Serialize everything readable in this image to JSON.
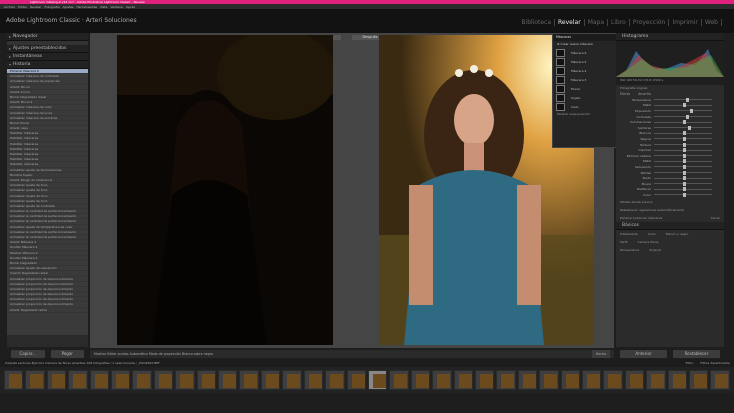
{
  "window": {
    "title": "Lightroom Catalog-2-v12 v17 - Adobe Photoshop Lightroom Classic - Revelar"
  },
  "menu": [
    "Archivo",
    "Editar",
    "Revelar",
    "Fotografía",
    "Ajustes",
    "Herramientas",
    "Vista",
    "Ventana",
    "Ayuda"
  ],
  "brand": "Adobe Lightroom Classic · Arteri Soluciones",
  "modules": [
    "Biblioteca",
    "Revelar",
    "Mapa",
    "Libro",
    "Proyección",
    "Imprimir",
    "Web"
  ],
  "active_module": "Revelar",
  "left_panel": {
    "navigator": "Navegador",
    "presets": "Ajustes preestablecidos",
    "snapshots": "Instantáneas",
    "history": "Historia",
    "history_items": [
      "Eliminar Máscara 6",
      "Actualizar máscara de contraste",
      "Actualizar máscara de exposición",
      "Añadir Pincel",
      "Añadir Curva",
      "Borrar Degradado lineal",
      "Añadir Pincel 2",
      "Actualizar máscara de color",
      "Actualizar máscara de luces",
      "Actualizar máscara de sombras",
      "Borrar Pincel",
      "Añadir capa",
      "Habilitar máscaras",
      "Habilitar máscaras",
      "Habilitar máscaras",
      "Habilitar máscaras",
      "Habilitar máscaras",
      "Habilitar máscaras",
      "Habilitar máscaras",
      "Actualizar ajuste de Iluminaciones",
      "Nombre Sujeto",
      "Añadir Rango de luminancia",
      "Actualizar Ajuste de tono",
      "Actualizar Ajuste de tono",
      "Actualizar Ajuste de tono",
      "Actualizar Ajuste de tono",
      "Actualizar ajuste de contraste",
      "Actualizar la cantidad de perfeccionamiento",
      "Actualizar la cantidad de perfeccionamiento",
      "Actualizar la cantidad de perfeccionamiento",
      "Actualizar ajuste de temperatura de color",
      "Actualizar la cantidad de perfeccionamiento",
      "Actualizar la cantidad de perfeccionamiento",
      "Añadir Máscara 2",
      "Ocultar Máscara 2",
      "Mostrar Máscara 2",
      "Ocultar Máscara 2",
      "Borrar Degradado",
      "Actualizar ajuste de exposición",
      "Invertir Degradado radial",
      "Actualizar proporción de desconocimiento",
      "Actualizar proporción de desconocimiento",
      "Actualizar proporción de desconocimiento",
      "Actualizar proporción de desconocimiento",
      "Actualizar proporción de desconocimiento",
      "Actualizar proporción de desconocimiento",
      "Añadir Degradado radial"
    ],
    "copy_button": "Copiar...",
    "paste_button": "Pegar"
  },
  "center": {
    "before_label": "Antes",
    "after_label": "Después",
    "toolbar_text": "Mostrar Editar puntos   Automático   Modo de proyección   Blanco sobre negro",
    "ready_button": "Hecho"
  },
  "masks_panel": {
    "title": "Máscaras",
    "create": "Crear nueva máscara",
    "items": [
      "Máscara 6",
      "Máscara 5",
      "Máscara 4",
      "Máscara 3",
      "Pincel",
      "Sujeto",
      "Cielo"
    ],
    "footer": "Mostrar superposición"
  },
  "right_panel": {
    "histogram_title": "Histograma",
    "histogram_info": "ISO 100   50 mm   f/2,8   1/500 s",
    "original_photo": "Fotografía original",
    "effect_label": "Efecto",
    "effect_value": "Amarillo",
    "sliders": [
      {
        "name": "Temperatura",
        "value": 0.55
      },
      {
        "name": "Matiz",
        "value": 0.5
      },
      {
        "name": "Exposición",
        "value": 0.62
      },
      {
        "name": "Contraste",
        "value": 0.55
      },
      {
        "name": "Iluminaciones",
        "value": 0.5
      },
      {
        "name": "Sombras",
        "value": 0.58
      },
      {
        "name": "Blancos",
        "value": 0.5
      },
      {
        "name": "Negros",
        "value": 0.5
      },
      {
        "name": "Textura",
        "value": 0.5
      },
      {
        "name": "Claridad",
        "value": 0.5
      },
      {
        "name": "Eliminar neblina",
        "value": 0.5
      },
      {
        "name": "Matiz",
        "value": 0.5
      },
      {
        "name": "Saturación",
        "value": 0.5
      },
      {
        "name": "Nitidez",
        "value": 0.5
      },
      {
        "name": "Ruido",
        "value": 0.5
      },
      {
        "name": "Muaré",
        "value": 0.5
      },
      {
        "name": "Desflecar",
        "value": 0.5
      },
      {
        "name": "Color",
        "value": 0.5
      }
    ],
    "fine_tune": "Utilizar Ajuste preciso",
    "reset_checkbox": "Restablecer reguladores automáticamente",
    "delete_all": "Eliminar todas las máscaras",
    "close": "Cerrar",
    "basic": "Básicos",
    "treatment": "Tratamiento",
    "color_mode": "Color",
    "bw_mode": "Blanco y negro",
    "profile_label": "Perfil",
    "profile_value": "Camera Plana",
    "temp_label": "Temperatura",
    "temp_value": "Original",
    "prev_button": "Anterior",
    "reset_button": "Restablecer"
  },
  "filmstrip": {
    "info": "Carpeta   Lecturas Ejercicio Camara de flores amarillas   108 fotografías / 1 seleccionada / _DSC6993.NEF",
    "filter_label": "Filtro:",
    "filter_value": "Filtros desactivados",
    "thumbnail_count": 34,
    "selected_index": 17
  }
}
